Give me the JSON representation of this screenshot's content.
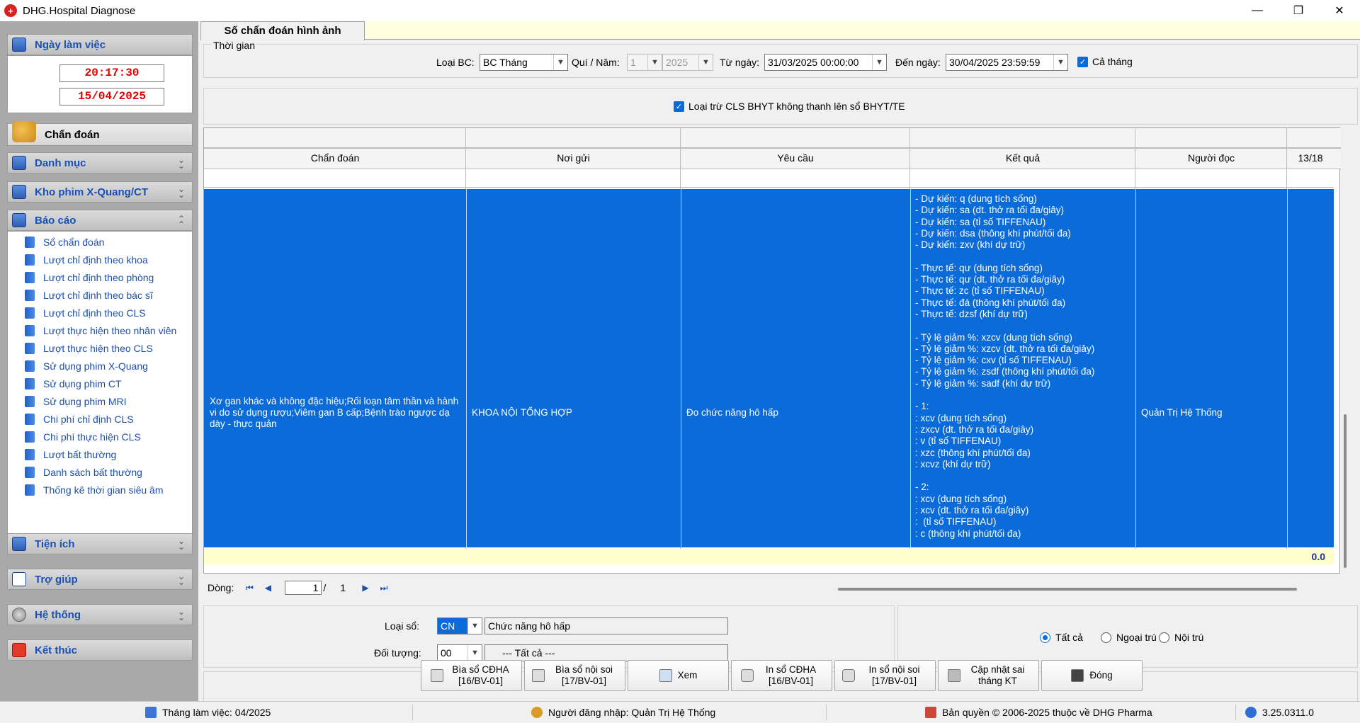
{
  "window": {
    "title": "DHG.Hospital Diagnose",
    "minimize": "—",
    "restore": "❐",
    "close": "✕"
  },
  "sidebar": {
    "working_day": {
      "label": "Ngày làm việc",
      "time": "20:17:30",
      "date": "15/04/2025"
    },
    "active_module": "Chẩn đoán",
    "sections": {
      "danh_muc": "Danh mục",
      "kho_phim": "Kho phim X-Quang/CT",
      "bao_cao": "Báo cáo",
      "tien_ich": "Tiện ích",
      "tro_giup": "Trợ giúp",
      "he_thong": "Hệ thống",
      "ket_thuc": "Kết thúc"
    },
    "report_items": [
      "Sổ chẩn đoán",
      "Lượt chỉ định theo khoa",
      "Lượt chỉ định theo phòng",
      "Lượt chỉ định theo bác sĩ",
      "Lượt chỉ định theo CLS",
      "Lượt thực hiện theo nhân viên",
      "Lượt thực hiện theo CLS",
      "Sử dụng phim X-Quang",
      "Sử dụng phim CT",
      "Sử dụng phim MRI",
      "Chi phí chỉ định CLS",
      "Chi phí thực hiện CLS",
      "Lượt bất thường",
      "Danh sách bất thường",
      "Thống kê thời gian siêu âm"
    ]
  },
  "tab": {
    "label": "Số chẩn đoán hình ảnh"
  },
  "time_group": {
    "legend": "Thời gian",
    "loai_bc_label": "Loại BC:",
    "loai_bc_value": "BC Tháng",
    "quy_nam_label": "Quí / Năm:",
    "quy_value": "1",
    "nam_value": "2025",
    "tu_ngay_label": "Từ ngày:",
    "tu_ngay_value": "31/03/2025 00:00:00",
    "den_ngay_label": "Đến ngày:",
    "den_ngay_value": "30/04/2025 23:59:59",
    "ca_thang_label": "Cả tháng"
  },
  "exclude_checkbox": "Loại trừ CLS BHYT không thanh lên sổ BHYT/TE",
  "grid": {
    "columns": [
      "Chẩn đoán",
      "Nơi gửi",
      "Yêu cầu",
      "Kết quả",
      "Người đọc",
      "13/18"
    ],
    "row": {
      "chan_doan": "Xơ gan khác và không đặc hiệu;Rối loạn tâm thần và hành vi do sử dụng rượu;Viêm gan B cấp;Bệnh trào ngược dạ dày - thực quản",
      "noi_gui": "KHOA NỘI TỔNG HỢP",
      "yeu_cau": "Đo chức năng hô hấp",
      "ket_qua": [
        "- Dự kiến: q (dung tích sống)",
        "- Dự kiến: sa (dt. thở ra tối đa/giây)",
        "- Dự kiến: sa (tỉ số TIFFENAU)",
        "- Dự kiến: dsa (thông khí phút/tối đa)",
        "- Dự kiến: zxv (khí dự trữ)",
        "",
        "- Thực tế: qư (dung tích sống)",
        "- Thực tế: qư (dt. thở ra tối đa/giây)",
        "- Thực tế: zc (tỉ số TIFFENAU)",
        "- Thực tế: đá (thông khí phút/tối đa)",
        "- Thực tế: dzsf (khí dự trữ)",
        "",
        "- Tỷ lệ giảm %: xzcv (dung tích sống)",
        "- Tỷ lệ giảm %: xzcv (dt. thở ra tối đa/giây)",
        "- Tỷ lệ giảm %: cxv (tỉ số TIFFENAU)",
        "- Tỷ lệ giảm %: zsdf (thông khí phút/tối đa)",
        "- Tỷ lệ giảm %: sadf (khí dự trữ)",
        "",
        "- 1:",
        ": xcv (dung tích sống)",
        ": zxcv (dt. thở ra tối đa/giây)",
        ": v (tỉ số TIFFENAU)",
        ": xzc (thông khí phút/tối đa)",
        ": xcvz (khí dự trữ)",
        "",
        "- 2:",
        ": xcv (dung tích sống)",
        ": xcv (dt. thở ra tối đa/giây)",
        ":  (tỉ số TIFFENAU)",
        ": c (thông khí phút/tối đa)"
      ],
      "nguoi_doc": "Quản Trị Hệ Thống"
    },
    "footer_sum": "0.0"
  },
  "navigator": {
    "label": "Dòng:",
    "page": "1",
    "sep": "/",
    "total": "1"
  },
  "filters": {
    "loai_so_label": "Loại sổ:",
    "loai_so_code": "CN",
    "loai_so_name": "Chức năng hô hấp",
    "doi_tuong_label": "Đối tượng:",
    "doi_tuong_code": "00",
    "doi_tuong_name": "--- Tất cả ---"
  },
  "radios": {
    "tat_ca": "Tất cả",
    "ngoai_tru": "Ngoại trú",
    "noi_tru": "Nội trú"
  },
  "buttons": {
    "bia_so_cdha": "Bìa sổ CĐHA [16/BV-01]",
    "bia_so_noi_soi": "Bìa sổ nội soi [17/BV-01]",
    "xem": "Xem",
    "in_so_cdha": "In sổ CĐHA [16/BV-01]",
    "in_so_noi_soi": "In sổ nội soi [17/BV-01]",
    "cap_nhat": "Cập nhật sai tháng KT",
    "dong": "Đóng"
  },
  "status": {
    "thang": "Tháng làm việc: 04/2025",
    "nguoi_dang_nhap": "Người đăng nhập: Quản Trị Hệ Thống",
    "ban_quyen": "Bản quyền © 2006-2025 thuộc về DHG Pharma",
    "version": "3.25.0311.0"
  }
}
